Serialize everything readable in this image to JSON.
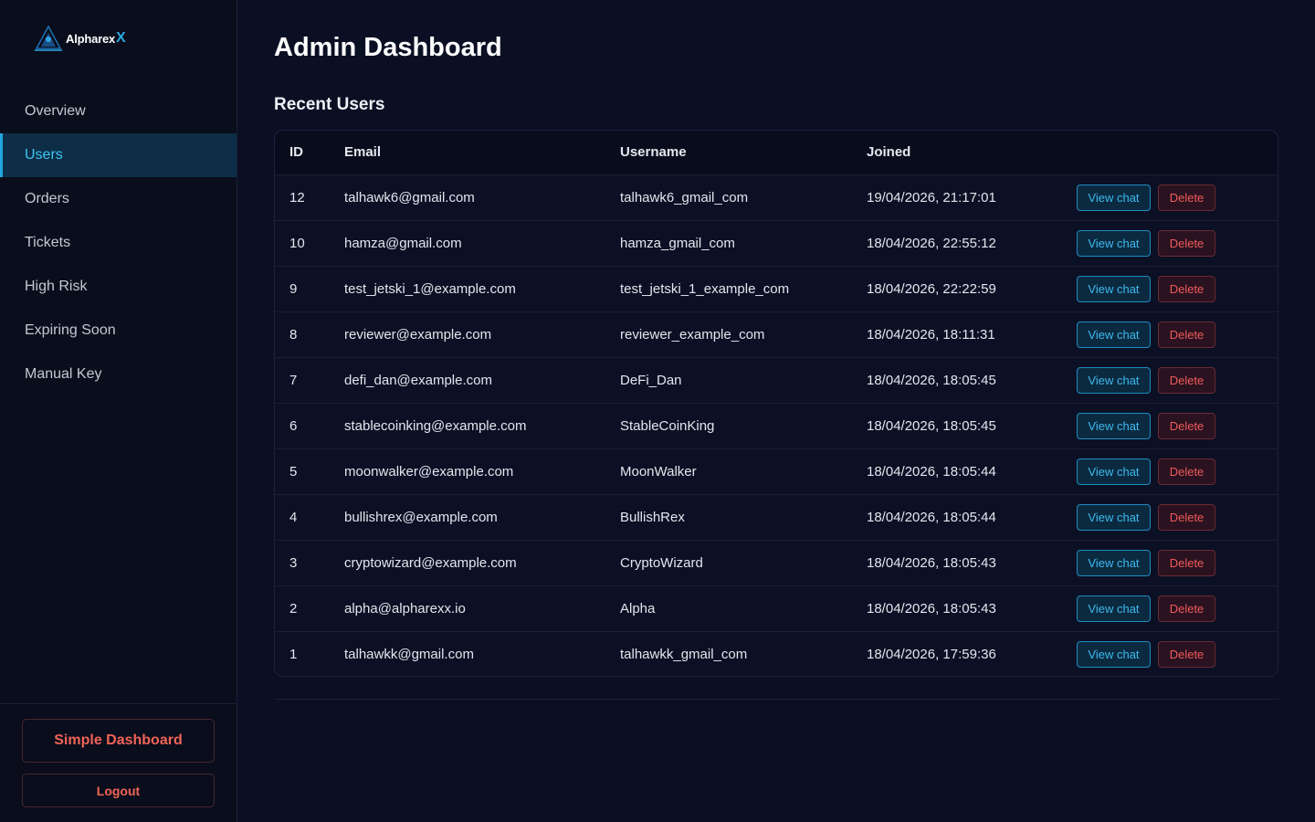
{
  "brand": {
    "name": "Alpharex",
    "suffix": "X"
  },
  "sidebar": {
    "items": [
      {
        "label": "Overview",
        "active": false
      },
      {
        "label": "Users",
        "active": true
      },
      {
        "label": "Orders",
        "active": false
      },
      {
        "label": "Tickets",
        "active": false
      },
      {
        "label": "High Risk",
        "active": false
      },
      {
        "label": "Expiring Soon",
        "active": false
      },
      {
        "label": "Manual Key",
        "active": false
      }
    ],
    "simple_dashboard_label": "Simple Dashboard",
    "logout_label": "Logout"
  },
  "main": {
    "title": "Admin Dashboard",
    "section_title": "Recent Users",
    "columns": [
      "ID",
      "Email",
      "Username",
      "Joined"
    ],
    "view_label": "View chat",
    "delete_label": "Delete",
    "rows": [
      {
        "id": "12",
        "email": "talhawk6@gmail.com",
        "username": "talhawk6_gmail_com",
        "joined": "19/04/2026, 21:17:01"
      },
      {
        "id": "10",
        "email": "hamza@gmail.com",
        "username": "hamza_gmail_com",
        "joined": "18/04/2026, 22:55:12"
      },
      {
        "id": "9",
        "email": "test_jetski_1@example.com",
        "username": "test_jetski_1_example_com",
        "joined": "18/04/2026, 22:22:59"
      },
      {
        "id": "8",
        "email": "reviewer@example.com",
        "username": "reviewer_example_com",
        "joined": "18/04/2026, 18:11:31"
      },
      {
        "id": "7",
        "email": "defi_dan@example.com",
        "username": "DeFi_Dan",
        "joined": "18/04/2026, 18:05:45"
      },
      {
        "id": "6",
        "email": "stablecoinking@example.com",
        "username": "StableCoinKing",
        "joined": "18/04/2026, 18:05:45"
      },
      {
        "id": "5",
        "email": "moonwalker@example.com",
        "username": "MoonWalker",
        "joined": "18/04/2026, 18:05:44"
      },
      {
        "id": "4",
        "email": "bullishrex@example.com",
        "username": "BullishRex",
        "joined": "18/04/2026, 18:05:44"
      },
      {
        "id": "3",
        "email": "cryptowizard@example.com",
        "username": "CryptoWizard",
        "joined": "18/04/2026, 18:05:43"
      },
      {
        "id": "2",
        "email": "alpha@alpharexx.io",
        "username": "Alpha",
        "joined": "18/04/2026, 18:05:43"
      },
      {
        "id": "1",
        "email": "talhawkk@gmail.com",
        "username": "talhawkk_gmail_com",
        "joined": "18/04/2026, 17:59:36"
      }
    ]
  },
  "colors": {
    "background": "#0b0f24",
    "sidebar": "#0a0d1c",
    "accent": "#3ec4f2",
    "danger": "#f05a5a"
  }
}
